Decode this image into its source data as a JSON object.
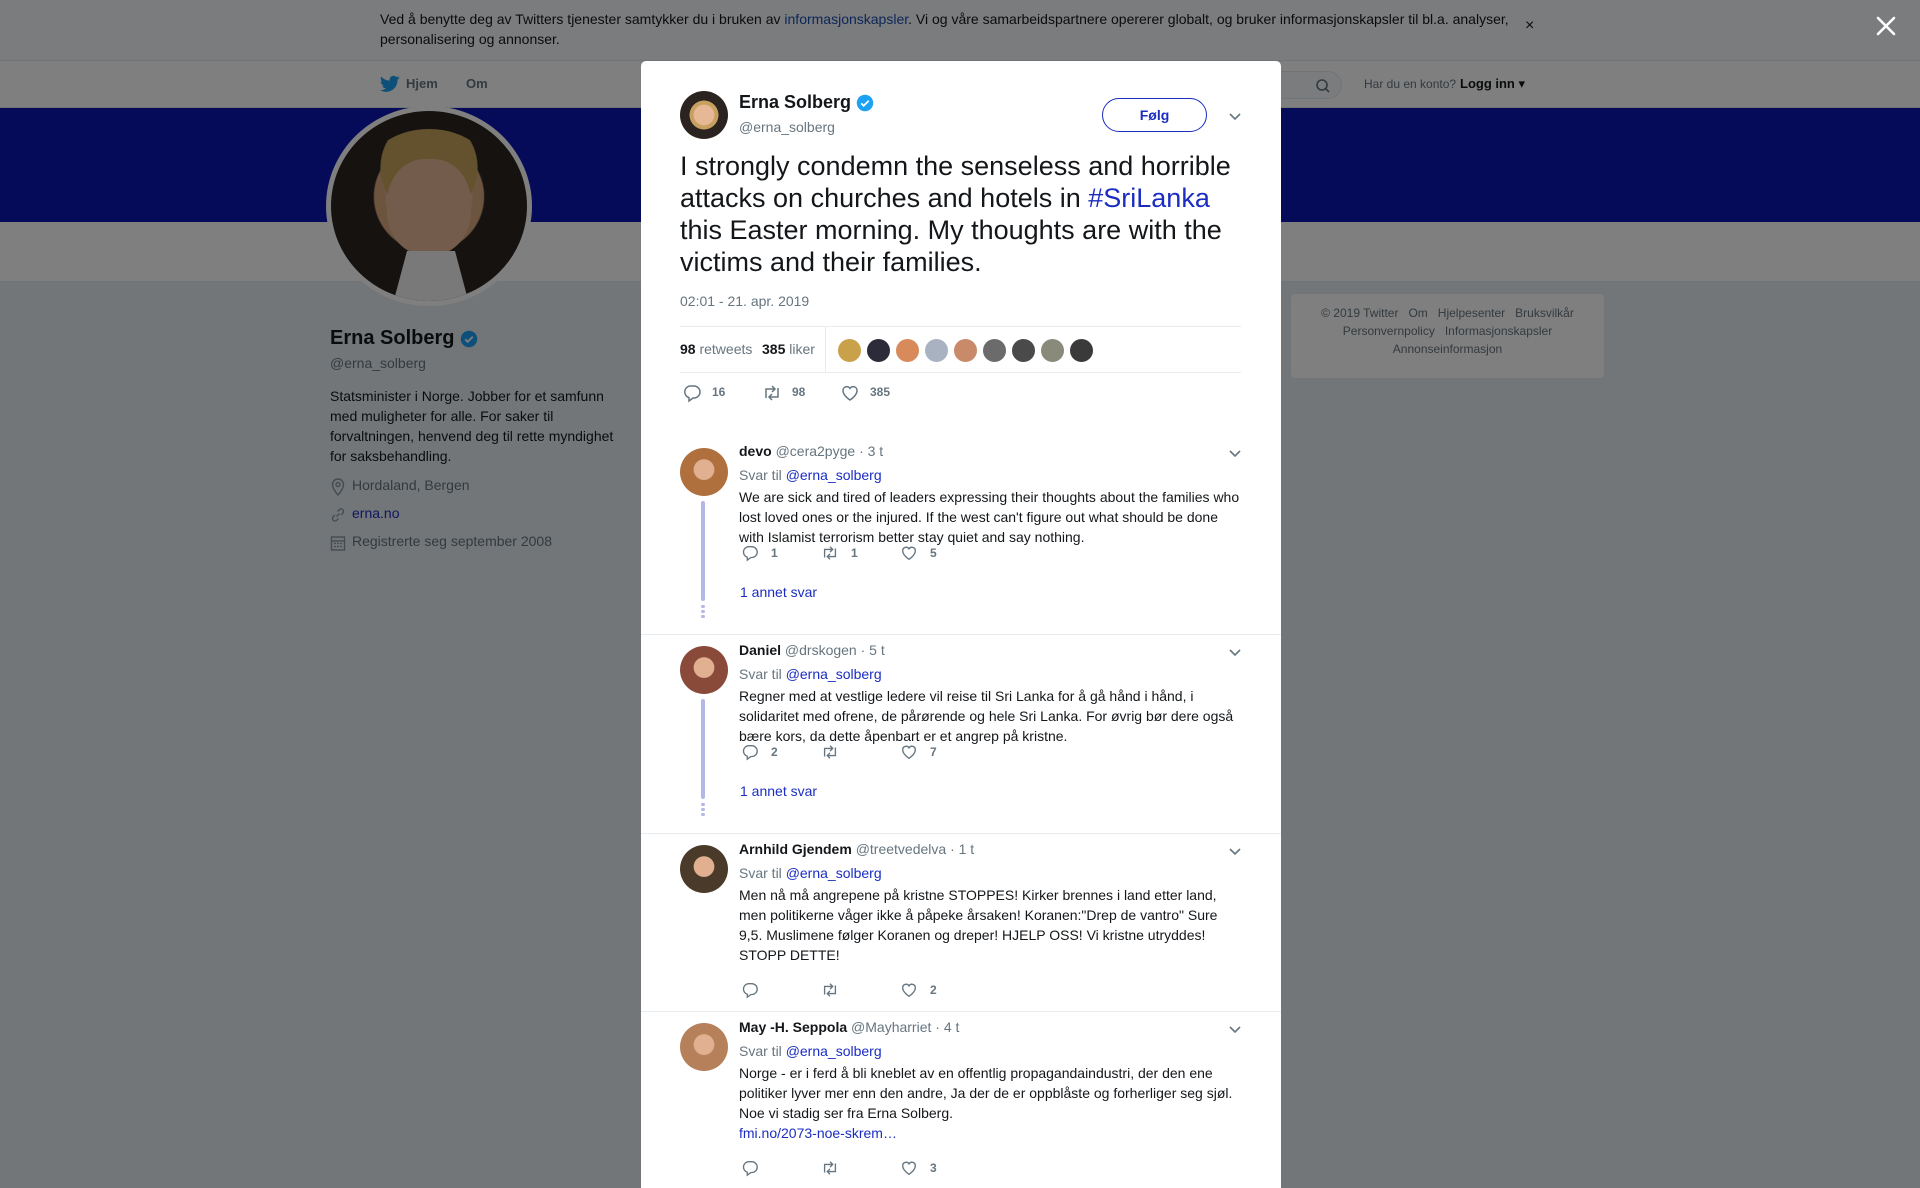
{
  "cookie_bar": {
    "text_before": "Ved å benytte deg av Twitters tjenester samtykker du i bruken av ",
    "link": "informasjonskapsler",
    "text_after": ". Vi og våre samarbeidspartnere opererer globalt, og bruker informasjonskapsler til bl.a. analyser, personalisering og annonser.",
    "close": "×"
  },
  "nav": {
    "home": "Hjem",
    "about": "Om",
    "login_question": "Har du en konto?",
    "login": "Logg inn ▾"
  },
  "profile": {
    "name": "Erna Solberg",
    "handle": "@erna_solberg",
    "bio": "Statsminister i Norge. Jobber for et samfunn med muligheter for alle. For saker til forvaltningen, henvend deg til rette myndighet for saksbehandling.",
    "location": "Hordaland, Bergen",
    "website": "erna.no",
    "joined": "Registrerte seg september 2008"
  },
  "footer": {
    "copyright": "© 2019 Twitter",
    "about": "Om",
    "help": "Hjelpesenter",
    "terms": "Bruksvilkår",
    "privacy": "Personvernpolicy",
    "cookies": "Informasjonskapsler",
    "ads": "Annonseinformasjon"
  },
  "tweet": {
    "author_name": "Erna Solberg",
    "author_handle": "@erna_solberg",
    "follow_label": "Følg",
    "text_part1": "I strongly condemn the senseless and horrible attacks on churches and hotels in ",
    "hashtag": "#SriLanka",
    "text_part2": " this Easter morning. My thoughts are with the victims and their families.",
    "timestamp": "02:01 - 21. apr. 2019",
    "retweets_count": "98",
    "retweets_label": "retweets",
    "likes_count": "385",
    "likes_label": "liker",
    "replies": "16",
    "retweets": "98",
    "likes": "385",
    "liker_colors": [
      "#c9a14a",
      "#2b2b3a",
      "#d88a5a",
      "#a9b2c0",
      "#c98a6a",
      "#6b6b6b",
      "#4a4a4a",
      "#8a8a7a",
      "#3a3a3a"
    ]
  },
  "replies": [
    {
      "name": "devo",
      "handle": "@cera2pyge",
      "time": "· 3 t",
      "reply_to_label": "Svar til ",
      "reply_to": "@erna_solberg",
      "text": "We are sick and tired of leaders expressing their thoughts about the families who lost loved ones or the injured. If the west can't figure out what should be done with Islamist terrorism better stay quiet and say nothing.",
      "replies": "1",
      "retweets": "1",
      "likes": "5",
      "more": "1 annet svar",
      "avatar_color": "#b0703e"
    },
    {
      "name": "Daniel",
      "handle": "@drskogen",
      "time": "· 5 t",
      "reply_to_label": "Svar til ",
      "reply_to": "@erna_solberg",
      "text": "Regner med at vestlige ledere vil reise til Sri Lanka for å gå hånd i hånd, i solidaritet med ofrene, de pårørende og hele Sri Lanka. For øvrig bør dere også bære kors, da dette åpenbart er et angrep på kristne.",
      "replies": "2",
      "retweets": "",
      "likes": "7",
      "more": "1 annet svar",
      "avatar_color": "#8a4a3a"
    },
    {
      "name": "Arnhild Gjendem",
      "handle": "@treetvedelva",
      "time": "· 1 t",
      "reply_to_label": "Svar til ",
      "reply_to": "@erna_solberg",
      "text": "Men nå må angrepene på kristne STOPPES! Kirker brennes i land etter land, men politikerne våger ikke å påpeke årsaken! Koranen:\"Drep de vantro\" Sure 9,5. Muslimene følger Koranen og dreper! HJELP OSS! Vi kristne utryddes! STOPP DETTE!",
      "replies": "",
      "retweets": "",
      "likes": "2",
      "avatar_color": "#4a3a2a"
    },
    {
      "name": "May -H. Seppola",
      "handle": "@Mayharriet",
      "time": "· 4 t",
      "reply_to_label": "Svar til ",
      "reply_to": "@erna_solberg",
      "text": "Norge - er i ferd å bli kneblet av en offentlig propagandaindustri, der den ene politiker lyver mer enn den andre, Ja der de er oppblåste og forherliger seg sjøl. Noe vi stadig ser fra Erna Solberg.",
      "link": "fmi.no/2073-noe-skrem…",
      "replies": "",
      "retweets": "",
      "likes": "3",
      "avatar_color": "#b5805a"
    }
  ]
}
